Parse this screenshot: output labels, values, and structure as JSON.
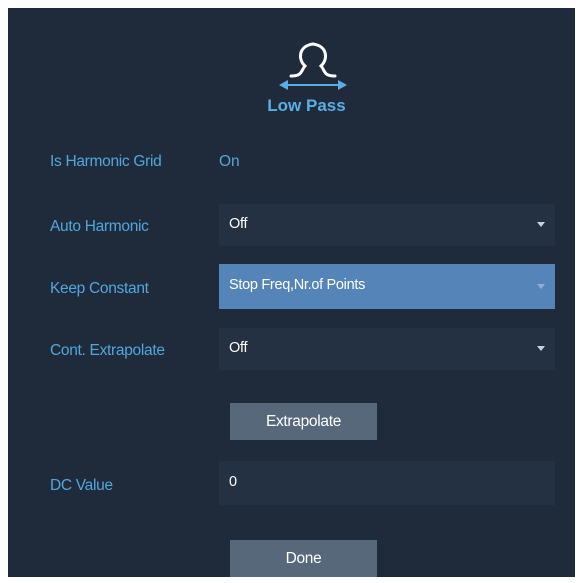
{
  "header": {
    "icon": "low-pass-loop-icon",
    "title": "Low Pass"
  },
  "rows": {
    "harmonic_grid": {
      "label": "Is Harmonic Grid",
      "value": "On"
    },
    "auto_harmonic": {
      "label": "Auto Harmonic",
      "value": "Off"
    },
    "keep_constant": {
      "label": "Keep Constant",
      "value": "Stop Freq,Nr.of Points"
    },
    "cont_extrapolate": {
      "label": "Cont. Extrapolate",
      "value": "Off"
    },
    "dc_value": {
      "label": "DC Value",
      "value": "0"
    }
  },
  "buttons": {
    "extrapolate": "Extrapolate",
    "done": "Done"
  },
  "colors": {
    "background": "#1f2b3a",
    "accent": "#52a6e0",
    "field": "#243142",
    "selected_field": "#5585b8",
    "button": "#56687a"
  }
}
